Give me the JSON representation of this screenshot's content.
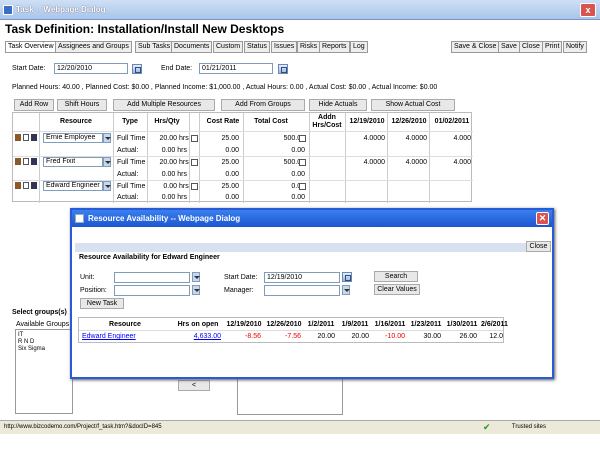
{
  "window": {
    "title": "Task -- Webpage Dialog",
    "close": "x"
  },
  "page_title": "Task Definition: Installation/Install New Desktops",
  "tabs": [
    "Task Overview",
    "Assignees and Groups",
    "Sub Tasks",
    "Documents",
    "Custom",
    "Status",
    "Issues",
    "Risks",
    "Reports",
    "Log"
  ],
  "actions": [
    "Save & Close",
    "Save",
    "Close",
    "Print",
    "Notify"
  ],
  "dates": {
    "start_label": "Start Date:",
    "start_value": "12/20/2010",
    "end_label": "End Date:",
    "end_value": "01/21/2011"
  },
  "summary": "Planned Hours:  40.00 , Planned Cost:  $0.00 , Planned Income:  $1,000.00  , Actual Hours:  0.00 , Actual Cost:  $0.00 , Actual Income:  $0.00",
  "toolbar": [
    "Add Row",
    "Shift Hours",
    "Add Multiple Resources",
    "Add From Groups",
    "Hide Actuals",
    "Show Actual Cost"
  ],
  "grid": {
    "headers": {
      "resource": "Resource",
      "type": "Type",
      "hrs": "Hrs/Qty",
      "rate": "Cost Rate",
      "total": "Total Cost",
      "addn": "Addn Hrs/Cost",
      "d1": "12/19/2010",
      "d2": "12/26/2010",
      "d3": "01/02/2011"
    },
    "rows": [
      {
        "name": "Ernie Employee",
        "type": "Full Time",
        "hrs": "20.00",
        "unit": "hrs",
        "rate": "25.00",
        "total": "500.00",
        "actual_label": "Actual:",
        "actual_hrs": "0.00 hrs",
        "actual_rate": "0.00",
        "actual_total": "0.00",
        "d1": "4.0000",
        "d2": "4.0000",
        "d3": "4.000"
      },
      {
        "name": "Fred Fixit",
        "type": "Full Time",
        "hrs": "20.00",
        "unit": "hrs",
        "rate": "25.00",
        "total": "500.00",
        "actual_label": "Actual:",
        "actual_hrs": "0.00 hrs",
        "actual_rate": "0.00",
        "actual_total": "0.00",
        "d1": "4.0000",
        "d2": "4.0000",
        "d3": "4.000"
      },
      {
        "name": "Edward Engineer",
        "type": "Full Time",
        "hrs": "0.00",
        "unit": "hrs",
        "rate": "25.00",
        "total": "0.00",
        "actual_label": "Actual:",
        "actual_hrs": "0.00 hrs",
        "actual_rate": "0.00",
        "actual_total": "0.00",
        "d1": "",
        "d2": "",
        "d3": ""
      }
    ]
  },
  "lower": {
    "select_groups": "Select groups(s)",
    "available_groups": "Available Groups",
    "groups": [
      "IT",
      "R N D",
      "Six Sigma"
    ],
    "move_left": "<"
  },
  "status": {
    "url": "http://www.bizcodemo.com/Project/f_task.htm?&docID=845",
    "zone": "Trusted sites"
  },
  "dialog": {
    "title": "Resource Availability -- Webpage Dialog",
    "close": "Close",
    "heading": "Resource Availability for Edward Engineer",
    "unit_label": "Unit:",
    "position_label": "Position:",
    "start_label": "Start Date:",
    "start_value": "12/19/2010",
    "manager_label": "Manager:",
    "search": "Search",
    "clear": "Clear Values",
    "new_task": "New Task",
    "headers": [
      "Resource",
      "Hrs on open",
      "12/19/2010",
      "12/26/2010",
      "1/2/2011",
      "1/9/2011",
      "1/16/2011",
      "1/23/2011",
      "1/30/2011",
      "2/6/2011"
    ],
    "row": {
      "resource": "Edward Engineer",
      "hrs_open": "4,633.00",
      "v1": "-8.56",
      "v2": "-7.56",
      "v3": "20.00",
      "v4": "20.00",
      "v5": "-10.00",
      "v6": "30.00",
      "v7": "26.00",
      "v8": "12.0"
    }
  }
}
